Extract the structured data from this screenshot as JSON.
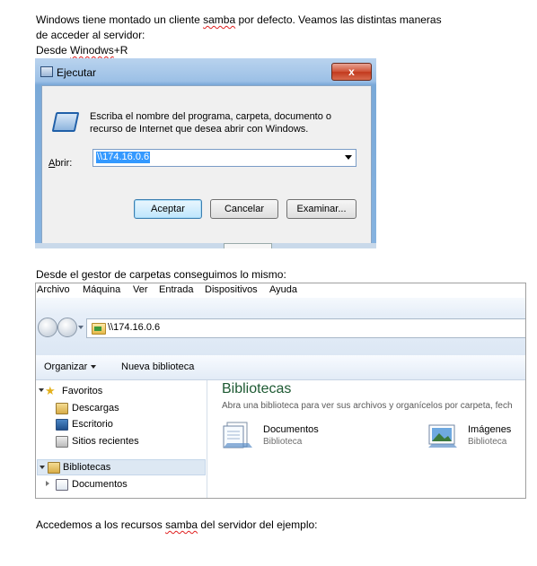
{
  "doc": {
    "intro_line1_a": "Windows tiene montado un cliente ",
    "intro_line1_b": "samba",
    "intro_line1_c": " por defecto. Veamos las distintas maneras",
    "intro_line2": "de acceder al servidor:",
    "desde_a": "Desde ",
    "desde_b": "Winodws",
    "desde_c": "+R",
    "gestor_line": "Desde el gestor de carpetas conseguimos lo mismo:",
    "final_a": "Accedemos a los recursos ",
    "final_b": "samba",
    "final_c": " del servidor del ejemplo:"
  },
  "run_dialog": {
    "title": "Ejecutar",
    "close_symbol": "x",
    "description": "Escriba el nombre del programa, carpeta, documento o recurso de Internet que desea abrir con Windows.",
    "open_label_a": "A",
    "open_label_b": "brir:",
    "input_value": "\\\\174.16.0.6",
    "buttons": {
      "accept": "Aceptar",
      "cancel": "Cancelar",
      "browse": "Examinar..."
    }
  },
  "explorer": {
    "menu": [
      "Archivo",
      "Máquina",
      "Ver",
      "Entrada",
      "Dispositivos",
      "Ayuda"
    ],
    "address": "\\\\174.16.0.6",
    "toolbar": {
      "organize": "Organizar",
      "new_library": "Nueva biblioteca"
    },
    "nav": {
      "favorites": "Favoritos",
      "downloads": "Descargas",
      "desktop": "Escritorio",
      "recent": "Sitios recientes",
      "libraries": "Bibliotecas",
      "documents": "Documentos"
    },
    "content": {
      "title": "Bibliotecas",
      "subtitle": "Abra una biblioteca para ver sus archivos y organícelos por carpeta, fech",
      "items": [
        {
          "name": "Documentos",
          "type": "Biblioteca"
        },
        {
          "name": "Imágenes",
          "type": "Biblioteca"
        }
      ]
    },
    "colors": {
      "title_green": "#1e5a33",
      "star": "#e4b11c",
      "selection": "#dde8f3"
    }
  }
}
